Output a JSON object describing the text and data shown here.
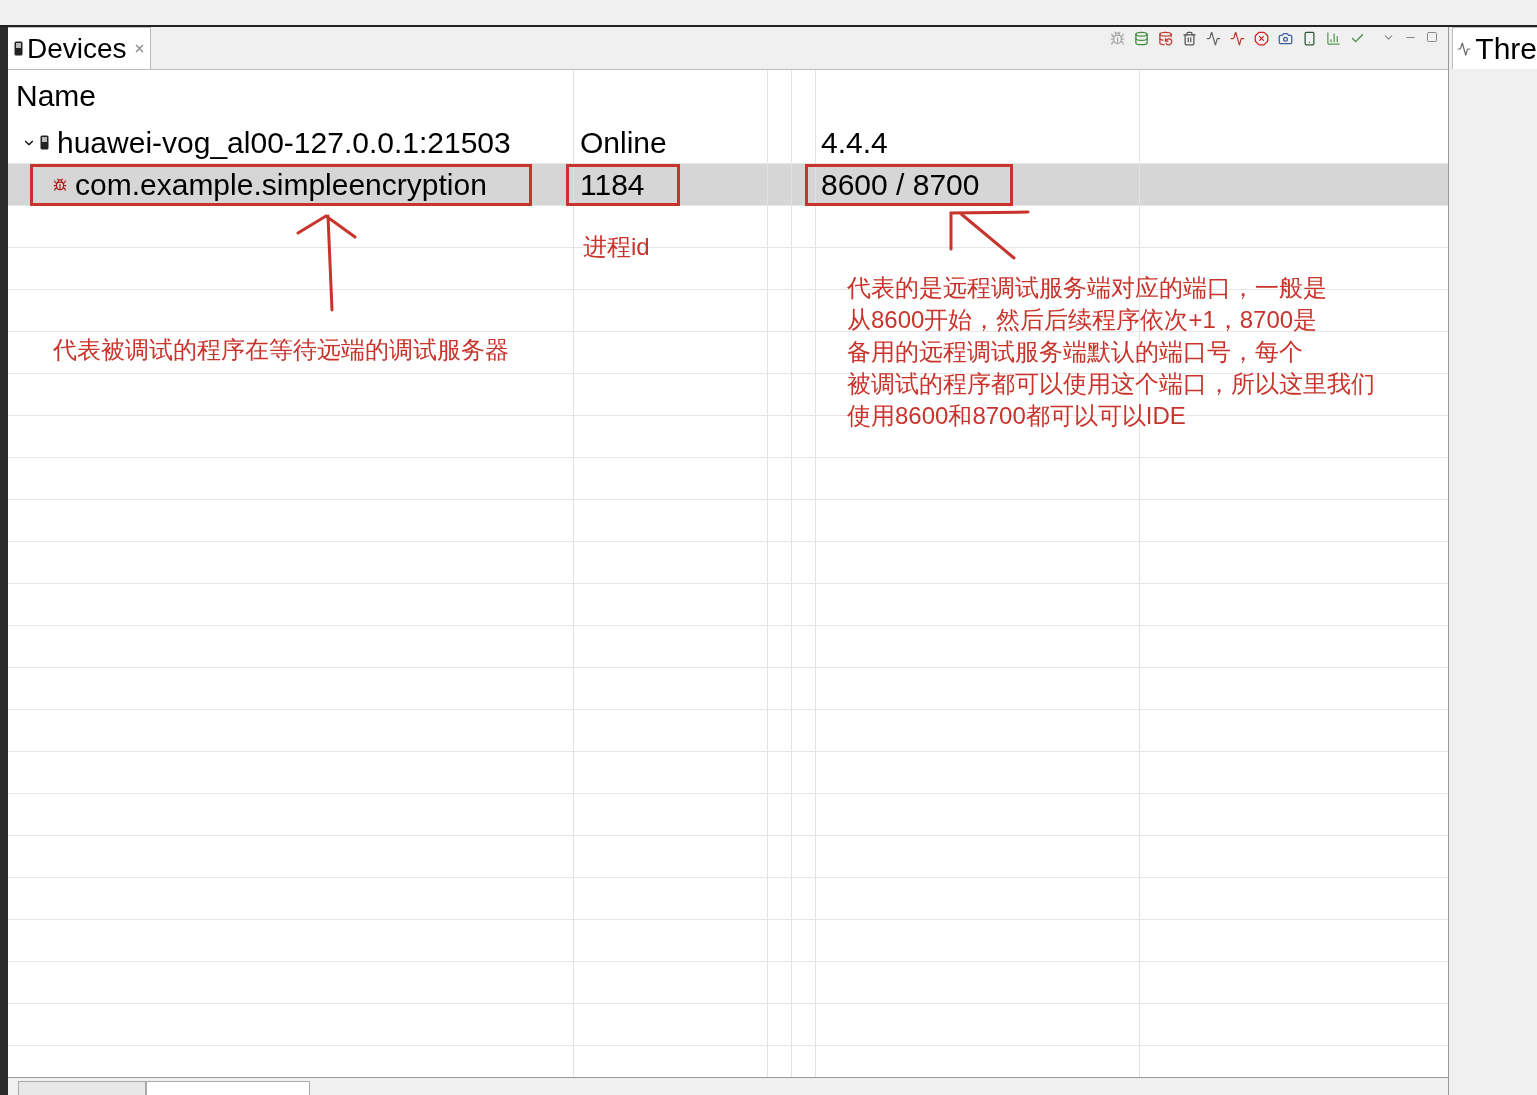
{
  "tabs": [
    {
      "label": "Devices",
      "selected": true
    }
  ],
  "right_panel": {
    "tab": "Thre"
  },
  "table": {
    "columns": [
      {
        "label": "Name"
      }
    ],
    "rows": [
      {
        "kind": "device",
        "expanded": true,
        "selected": false,
        "highlighted": false,
        "name": "huawei-vog_al00-127.0.0.1:21503",
        "column_2": "Online",
        "column_5": "4.4.4",
        "children": [
          {
            "kind": "process",
            "selected": true,
            "highlighted": true,
            "name": "com.example.simpleencryption",
            "column_2": "1184",
            "column_5": "8600 / 8700"
          }
        ]
      }
    ]
  },
  "bottom_tabs": [
    {
      "selected": false
    },
    {
      "selected": true
    }
  ],
  "annotations": [
    {
      "kind": "note",
      "text": "进程id"
    },
    {
      "kind": "note",
      "text": "代表被调试的程序在等待远端的调试服务器"
    },
    {
      "kind": "lines",
      "lines": [
        "代表的是远程调试服务端对应的端口，一般是",
        "从8600开始，然后后续程序依次+1，8700是",
        "备用的远程调试服务端默认的端口号，每个",
        "被调试的程序都可以使用这个端口，所以这里我们",
        "使用8600和8700都可以可以IDE"
      ]
    }
  ]
}
